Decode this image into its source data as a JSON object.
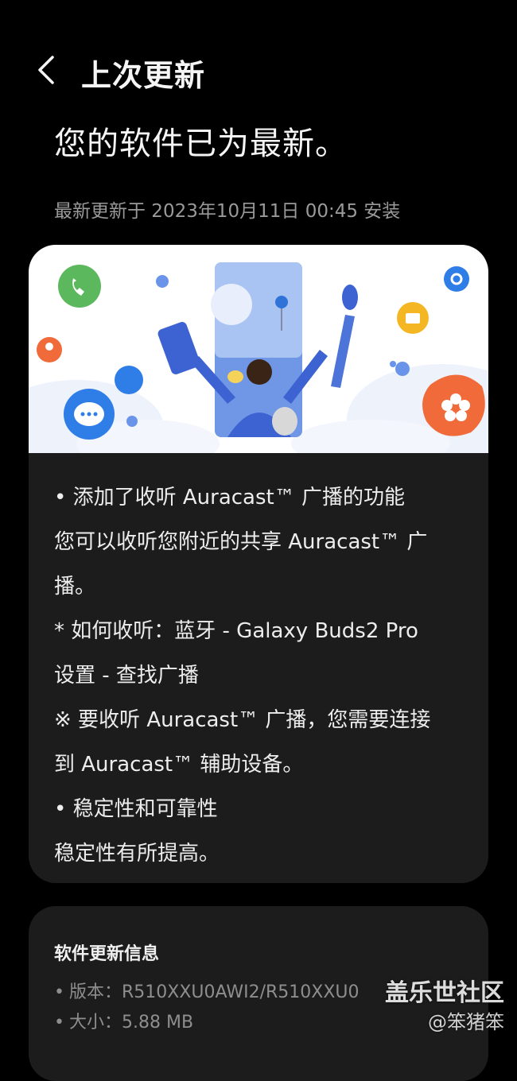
{
  "header": {
    "back_icon": "chevron-left-icon",
    "title": "上次更新"
  },
  "status": {
    "title": "您的软件已为最新。",
    "installed_line": "最新更新于 2023年10月11日 00:45 安装"
  },
  "release_notes": {
    "lines": [
      "• 添加了收听 Auracast™ 广播的功能",
      "您可以收听您附近的共享 Auracast™ 广",
      "播。",
      "* 如何收听：蓝牙 - Galaxy Buds2 Pro",
      "设置 - 查找广播",
      "※ 要收听 Auracast™ 广播，您需要连接",
      "到 Auracast™ 辅助设备。",
      "• 稳定性和可靠性",
      "稳定性有所提高。"
    ]
  },
  "software_info": {
    "title": "软件更新信息",
    "version_label": "版本：",
    "version_value": "R510XXU0AWI2/R510XXU0",
    "size_label": "大小：",
    "size_value": "5.88 MB"
  },
  "watermark": {
    "main": "盖乐世社区",
    "sub": "@笨猪笨"
  },
  "colors": {
    "background": "#000000",
    "card": "#1c1c1c",
    "primary_text": "#f2f2f2",
    "secondary_text": "#9a9a9a",
    "illustration_blue": "#4a6fd6",
    "accent_orange": "#f06a3a",
    "accent_green": "#5cb85c",
    "accent_yellow": "#f5b623"
  }
}
